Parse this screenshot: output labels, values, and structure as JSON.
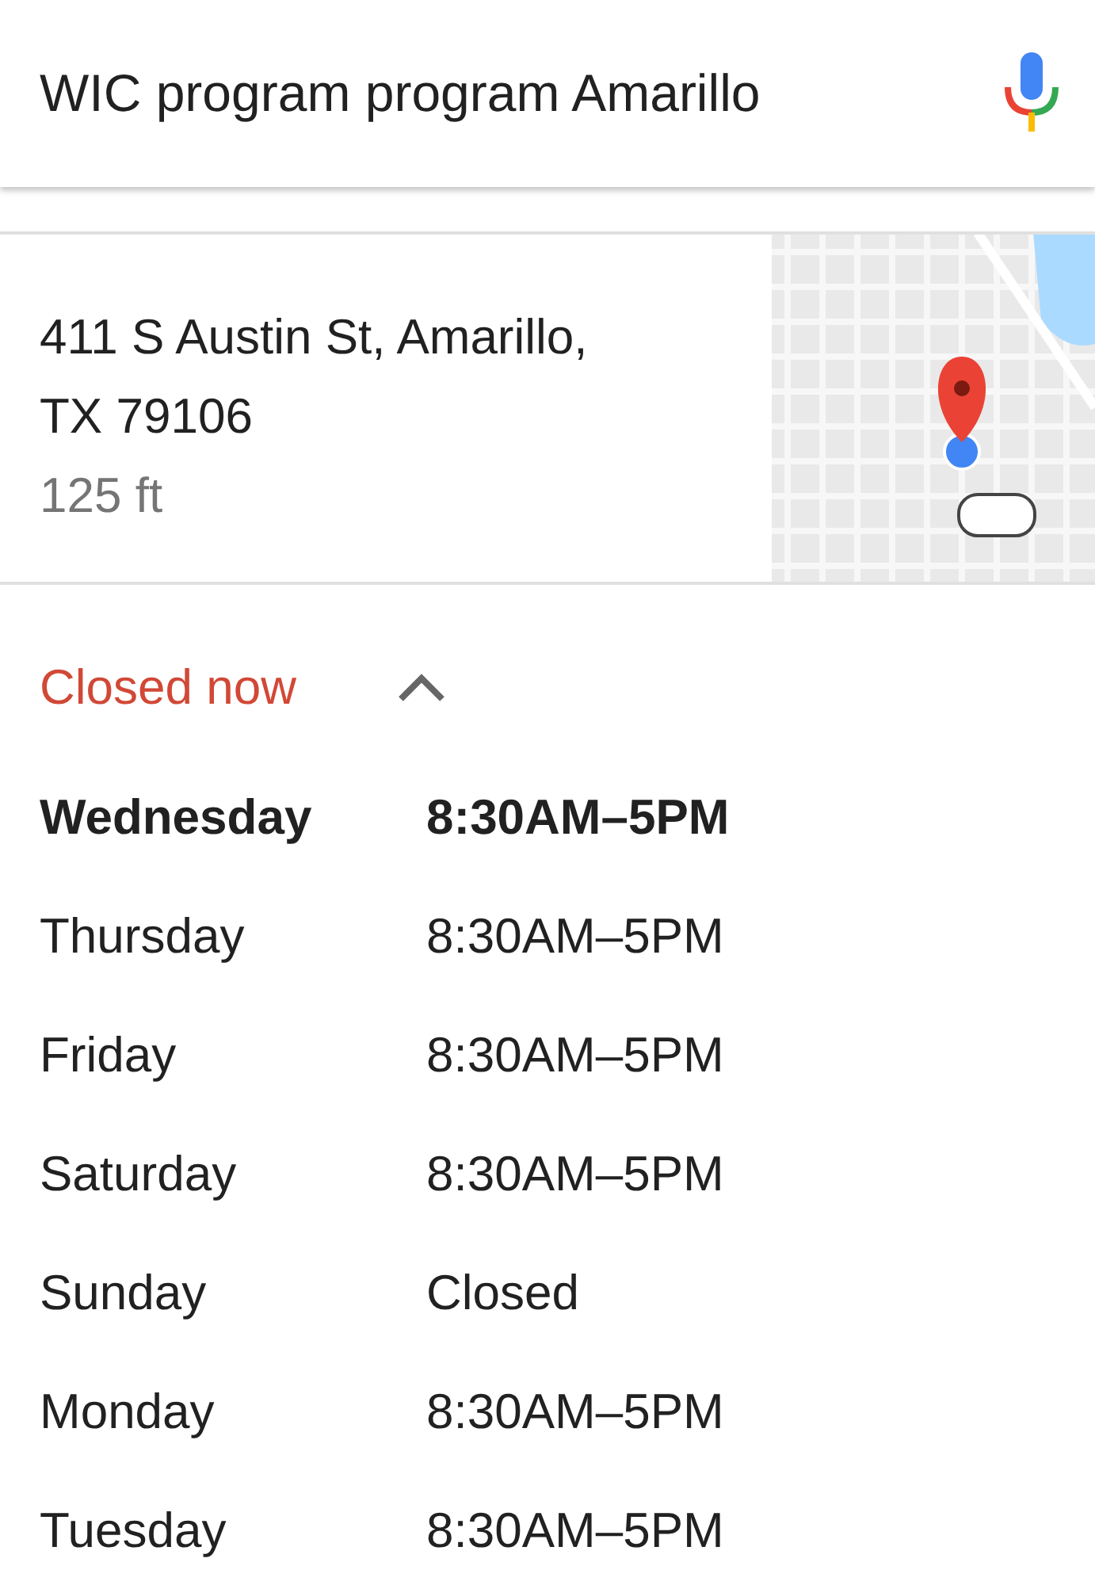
{
  "search": {
    "query": "WIC program program Amarillo"
  },
  "place": {
    "address_lines": [
      "411 S Austin St, Amarillo,",
      "TX 79106"
    ],
    "distance": "125 ft"
  },
  "hours": {
    "status": "Closed now",
    "expanded": true,
    "days": [
      {
        "day": "Wednesday",
        "hours": "8:30AM–5PM",
        "selected": true
      },
      {
        "day": "Thursday",
        "hours": "8:30AM–5PM",
        "selected": false
      },
      {
        "day": "Friday",
        "hours": "8:30AM–5PM",
        "selected": false
      },
      {
        "day": "Saturday",
        "hours": "8:30AM–5PM",
        "selected": false
      },
      {
        "day": "Sunday",
        "hours": "Closed",
        "selected": false
      },
      {
        "day": "Monday",
        "hours": "8:30AM–5PM",
        "selected": false
      },
      {
        "day": "Tuesday",
        "hours": "8:30AM–5PM",
        "selected": false
      }
    ]
  }
}
